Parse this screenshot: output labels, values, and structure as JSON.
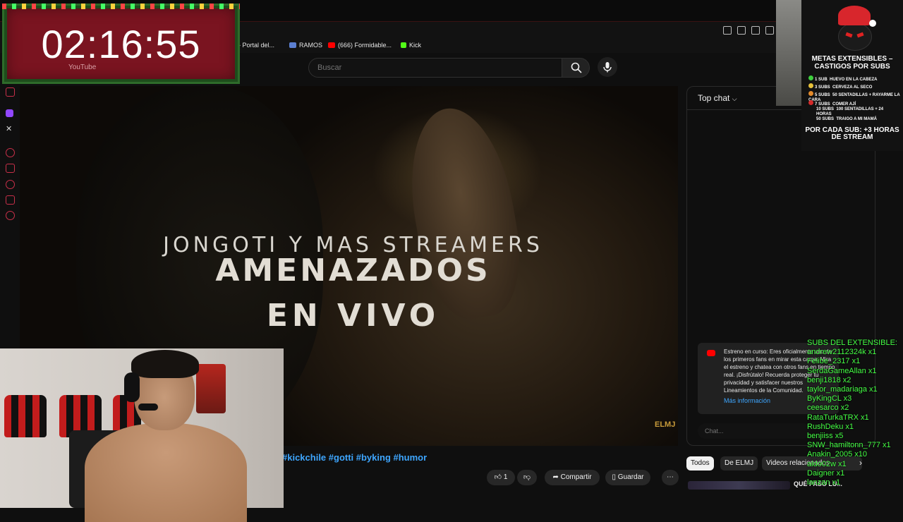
{
  "browser": {
    "bookmarks": [
      {
        "label": "- Portal del...",
        "icon": "portal-icon",
        "color": "#888888"
      },
      {
        "label": "RAMOS",
        "icon": "ramos-icon",
        "color": "#5b7fd1"
      },
      {
        "label": "(666) Formidable...",
        "icon": "youtube-icon",
        "color": "#ff0000"
      },
      {
        "label": "Kick",
        "icon": "kick-icon",
        "color": "#53fc18"
      }
    ]
  },
  "header": {
    "search_placeholder": "Buscar"
  },
  "video": {
    "line1": "JONGOTI Y MAS STREAMERS",
    "line2": "AMENAZADOS",
    "line3": "EN VIVO",
    "watermark": "ELMJ"
  },
  "description": {
    "hashtags": "#kickchile #gotti #byking #humor"
  },
  "actions": {
    "like_count": "1",
    "share_label": "Compartir",
    "save_label": "Guardar"
  },
  "chat": {
    "mode_label": "Top chat",
    "notice_text": "Estreno en curso: Eres oficialmente uno de los primeros fans en mirar esta carga. Mira el estreno y chatea con otros fans en tiempo real. ¡Disfrútalo! Recuerda proteger tu privacidad y satisfacer nuestros Lineamientos de la Comunidad.",
    "notice_link": "Más información",
    "input_placeholder": "Chat..."
  },
  "chips": {
    "all": "Todos",
    "from": "De ELMJ",
    "related": "Videos relacionados"
  },
  "up_next_label": "QUÉ PASÓ LU...",
  "timer": {
    "time": "02:16:55",
    "ghost_label": "YouTube"
  },
  "goals": {
    "title": "METAS EXTENSIBLES – CASTIGOS POR SUBS",
    "rows": [
      {
        "subs": "1 SUB",
        "punishment": "HUEVO EN LA CABEZA",
        "color": "#3ecf3e"
      },
      {
        "subs": "3 SUBS",
        "punishment": "CERVEZA AL SECO",
        "color": "#e7c13b"
      },
      {
        "subs": "5 SUBS",
        "punishment": "50 SENTADILLAS + RAYARME LA CARA",
        "color": "#e38a2b"
      },
      {
        "subs": "7 SUBS",
        "punishment": "COMER AJÍ",
        "color": "#d42a2a"
      },
      {
        "subs": "10 SUBS",
        "punishment": "100 SENTADILLAS + 24 HORAS",
        "color": ""
      },
      {
        "subs": "50 SUBS",
        "punishment": "TRAIGO A MI MAMÁ",
        "color": ""
      }
    ],
    "footer": "POR CADA SUB: +3 HORAS DE STREAM"
  },
  "subs_list": {
    "title": "SUBS DEL EXTENSIBLE:",
    "entries": [
      "andrew2112324k x1",
      "Felibe_2317 x1",
      "SerdaGameAllan x1",
      "benji1818 x2",
      "taylor_madariaga x1",
      "ByKingCL x3",
      "ceesarco x2",
      "RataTurkaTRX x1",
      "RushDeku x1",
      "benjiiss x5",
      "SNW_hamiltonn_777 x1",
      "Anakin_2005 x10",
      "aldo02w x1",
      "Daigner x1",
      "lanzan x1"
    ]
  }
}
